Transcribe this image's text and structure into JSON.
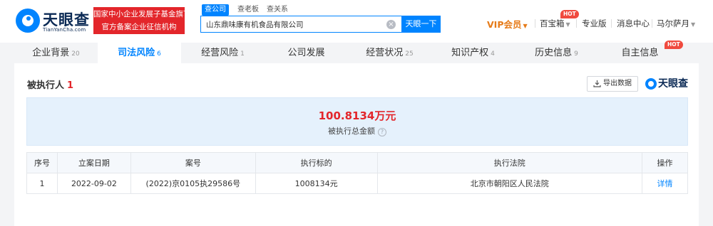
{
  "brand": {
    "name_cn": "天眼查",
    "name_en": "TianYanCha.com"
  },
  "gov_badge": {
    "line1": "国家中小企业发展子基金旗下",
    "line2": "官方备案企业征信机构"
  },
  "search": {
    "tabs": [
      "查公司",
      "查老板",
      "查关系"
    ],
    "active_tab": "查公司",
    "value": "山东鼎味康有机食品有限公司",
    "button_label": "天眼一下"
  },
  "nav": {
    "vip": "VIP会员",
    "treasure": "百宝箱",
    "pro": "专业版",
    "messages": "消息中心",
    "user": "马尔萨月",
    "hot_badge": "HOT"
  },
  "category_tabs": [
    {
      "label": "企业背景",
      "count": "20",
      "active": false
    },
    {
      "label": "司法风险",
      "count": "6",
      "active": true
    },
    {
      "label": "经营风险",
      "count": "1",
      "active": false
    },
    {
      "label": "公司发展",
      "count": "",
      "active": false
    },
    {
      "label": "经营状况",
      "count": "25",
      "active": false
    },
    {
      "label": "知识产权",
      "count": "4",
      "active": false
    },
    {
      "label": "历史信息",
      "count": "9",
      "active": false
    },
    {
      "label": "自主信息",
      "count": "",
      "active": false
    }
  ],
  "section": {
    "title": "被执行人",
    "count": "1",
    "export_label": "导出数据",
    "brand_mark": "天眼查"
  },
  "summary": {
    "amount": "100.8134万元",
    "label": "被执行总金额"
  },
  "table": {
    "headers": [
      "序号",
      "立案日期",
      "案号",
      "执行标的",
      "执行法院",
      "操作"
    ],
    "rows": [
      [
        "1",
        "2022-09-02",
        "(2022)京0105执29586号",
        "1008134元",
        "北京市朝阳区人民法院",
        "详情"
      ]
    ]
  },
  "colors": {
    "primary": "#0084ff",
    "danger": "#e3262b",
    "vip": "#e67b19"
  }
}
